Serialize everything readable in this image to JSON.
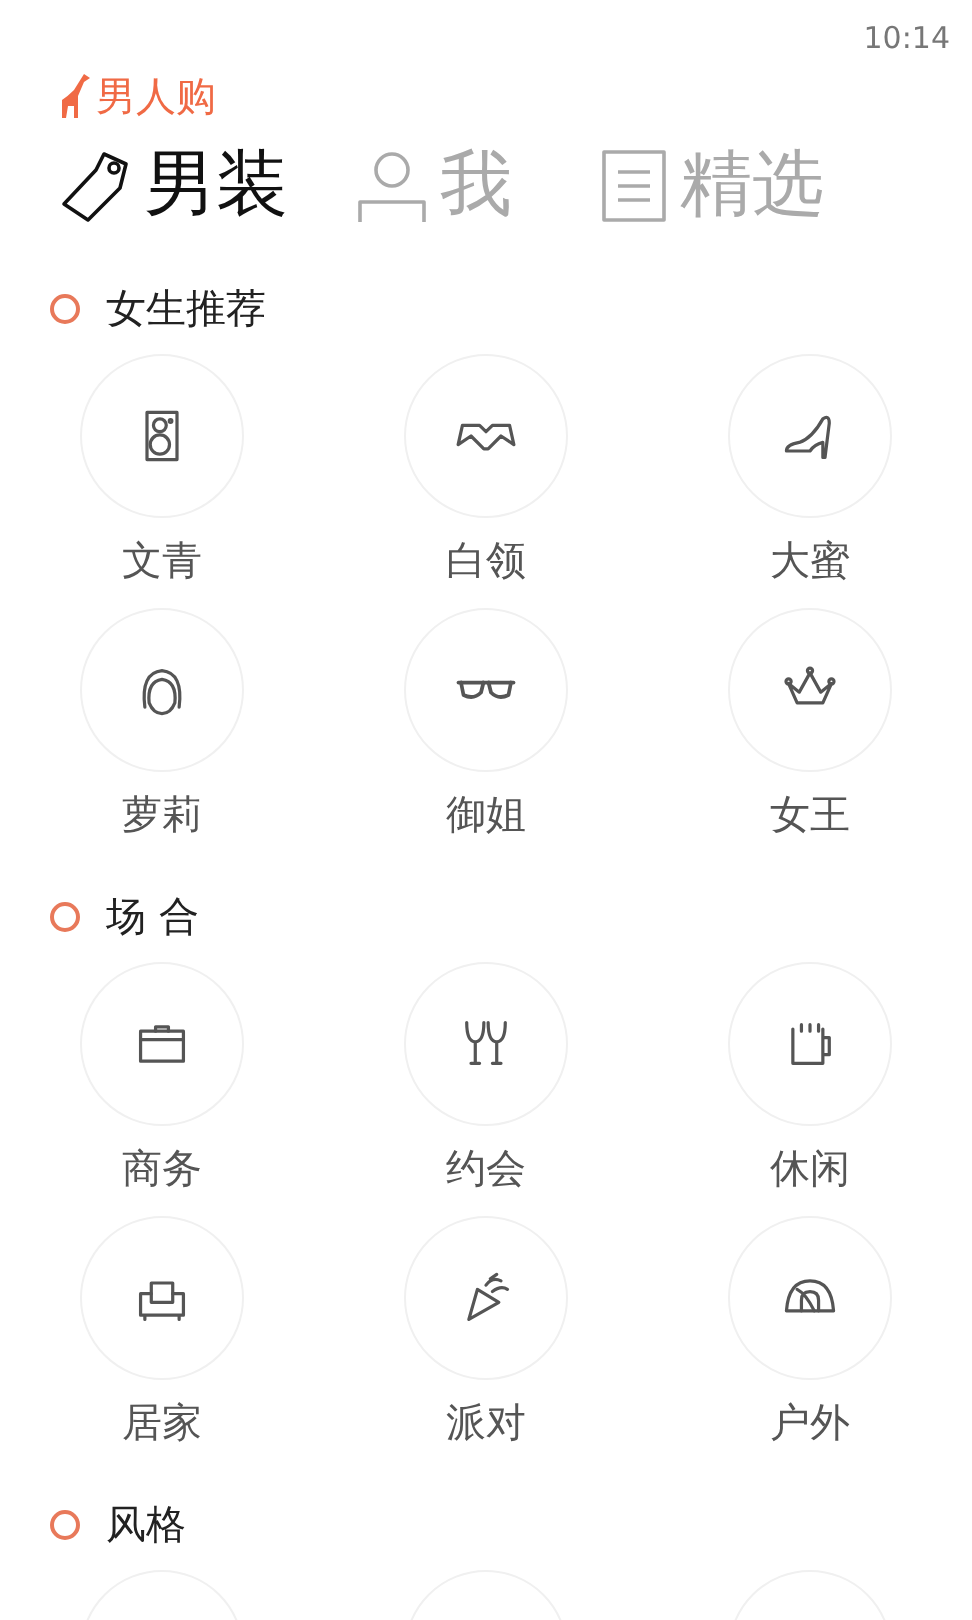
{
  "status_bar": {
    "time": "10:14"
  },
  "app": {
    "name": "男人购"
  },
  "tabs": [
    {
      "label": "男装",
      "selected": true
    },
    {
      "label": "我",
      "selected": false
    },
    {
      "label": "精选",
      "selected": false
    }
  ],
  "sections": [
    {
      "title": "女生推荐",
      "items": [
        {
          "label": "文青"
        },
        {
          "label": "白领"
        },
        {
          "label": "大蜜"
        },
        {
          "label": "萝莉"
        },
        {
          "label": "御姐"
        },
        {
          "label": "女王"
        }
      ]
    },
    {
      "title": "场 合",
      "items": [
        {
          "label": "商务"
        },
        {
          "label": "约会"
        },
        {
          "label": "休闲"
        },
        {
          "label": "居家"
        },
        {
          "label": "派对"
        },
        {
          "label": "户外"
        }
      ]
    },
    {
      "title": "风格"
    }
  ]
}
